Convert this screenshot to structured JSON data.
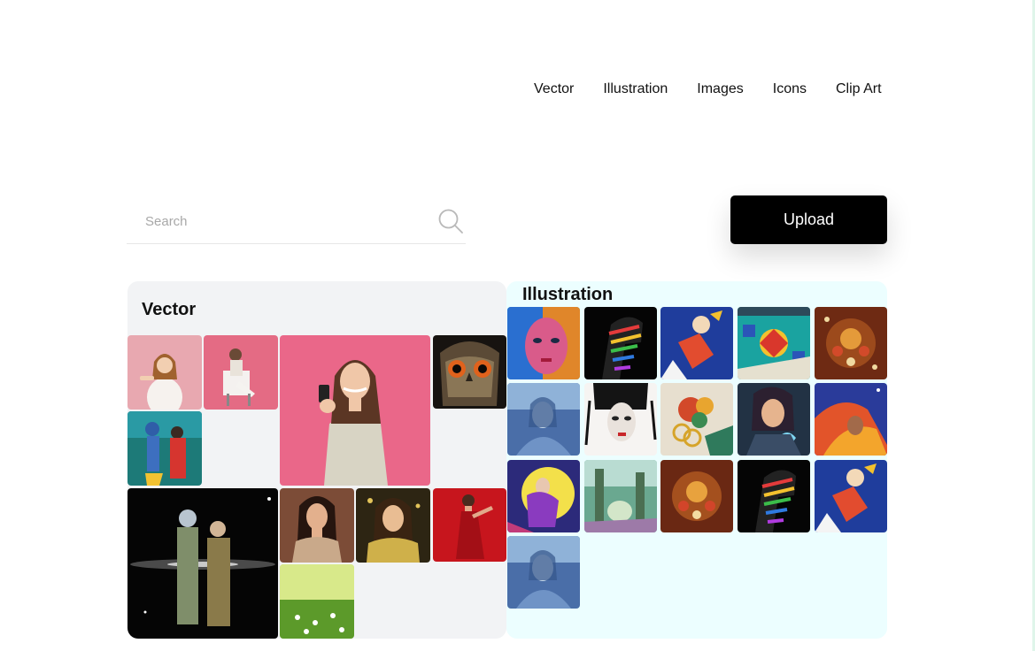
{
  "nav": {
    "items": [
      "Vector",
      "Illustration",
      "Images",
      "Icons",
      "Clip Art"
    ]
  },
  "search": {
    "placeholder": "Search",
    "icon": "search-icon"
  },
  "upload": {
    "label": "Upload"
  },
  "sections": {
    "vector": {
      "title": "Vector"
    },
    "illustration": {
      "title": "Illustration"
    }
  },
  "colors": {
    "vector_panel_bg": "#f2f3f5",
    "illustration_panel_bg": "#ecfeff",
    "upload_bg": "#000000",
    "accent_strip": "#dff5ea"
  }
}
